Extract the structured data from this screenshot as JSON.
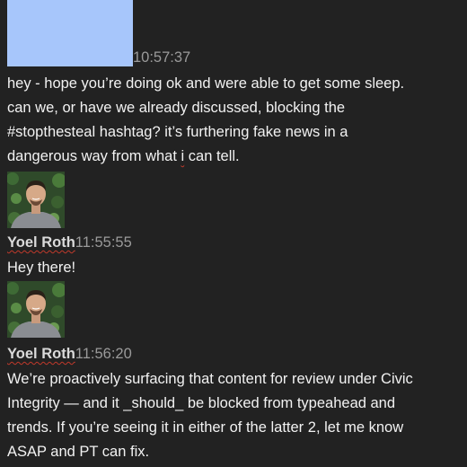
{
  "messages": [
    {
      "sender": "",
      "time": "10:57:37",
      "text_lines": [
        "hey - hope you’re doing ok and were able to get some sleep.",
        "can we, or have we already discussed, blocking the",
        "#stopthesteal hashtag? it’s furthering fake news in a",
        "dangerous way from what ",
        "i",
        " can tell."
      ]
    },
    {
      "sender": "Yoel Roth",
      "time": "11:55:55",
      "text": "Hey there!",
      "avatar": "person-avatar"
    },
    {
      "sender": "Yoel Roth",
      "time": "11:56:20",
      "text_lines": [
        "We’re proactively surfacing that content for review under Civic",
        "Integrity — and it _should_ be blocked from typeahead and",
        "trends. If you’re seeing it in either of the latter 2, let me know",
        "ASAP and PT can fix."
      ],
      "avatar": "person-avatar"
    }
  ],
  "colors": {
    "background": "#222222",
    "redaction": "#a7c6fb",
    "text": "#f2f2f2",
    "timestamp": "#9a9a9a",
    "spellcheck": "#c0392b"
  }
}
